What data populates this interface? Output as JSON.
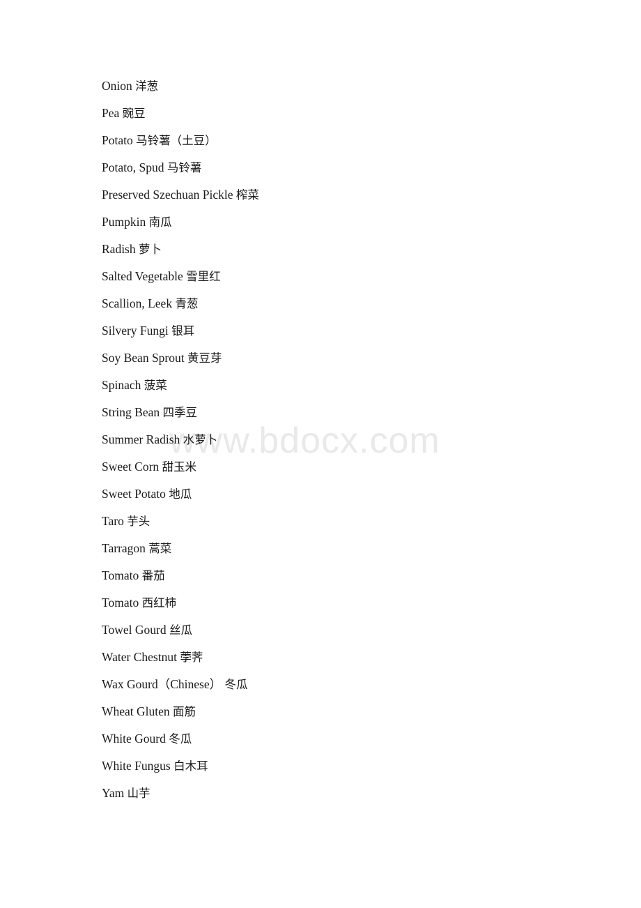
{
  "document": {
    "watermark": "www.bdocx.com",
    "entries": [
      {
        "english": "Onion",
        "chinese": "洋葱",
        "text": "Onion 洋葱"
      },
      {
        "english": "Pea",
        "chinese": "豌豆",
        "text": "Pea 豌豆"
      },
      {
        "english": "Potato",
        "chinese": "马铃薯（土豆）",
        "text": "Potato 马铃薯（土豆）"
      },
      {
        "english": "Potato, Spud",
        "chinese": "马铃薯",
        "text": "Potato, Spud 马铃薯"
      },
      {
        "english": "Preserved Szechuan Pickle",
        "chinese": "榨菜",
        "text": "Preserved Szechuan Pickle 榨菜"
      },
      {
        "english": "Pumpkin",
        "chinese": "南瓜",
        "text": "Pumpkin 南瓜"
      },
      {
        "english": "Radish",
        "chinese": "萝卜",
        "text": "Radish 萝卜"
      },
      {
        "english": "Salted Vegetable",
        "chinese": "雪里红",
        "text": "Salted Vegetable 雪里红"
      },
      {
        "english": "Scallion, Leek",
        "chinese": "青葱",
        "text": "Scallion, Leek 青葱"
      },
      {
        "english": "Silvery Fungi",
        "chinese": "银耳",
        "text": "Silvery Fungi 银耳"
      },
      {
        "english": "Soy Bean Sprout",
        "chinese": "黄豆芽",
        "text": "Soy Bean Sprout 黄豆芽"
      },
      {
        "english": "Spinach",
        "chinese": "菠菜",
        "text": "Spinach 菠菜"
      },
      {
        "english": "String Bean",
        "chinese": "四季豆",
        "text": "String Bean 四季豆"
      },
      {
        "english": "Summer Radish",
        "chinese": "水萝卜",
        "text": "Summer Radish 水萝卜"
      },
      {
        "english": "Sweet Corn",
        "chinese": "甜玉米",
        "text": "Sweet Corn 甜玉米"
      },
      {
        "english": "Sweet Potato",
        "chinese": "地瓜",
        "text": "Sweet Potato 地瓜"
      },
      {
        "english": "Taro",
        "chinese": "芋头",
        "text": "Taro 芋头"
      },
      {
        "english": "Tarragon",
        "chinese": "蒿菜",
        "text": "Tarragon 蒿菜"
      },
      {
        "english": "Tomato",
        "chinese": "番茄",
        "text": "Tomato 番茄"
      },
      {
        "english": "Tomato",
        "chinese": "西红柿",
        "text": "Tomato 西红柿"
      },
      {
        "english": "Towel Gourd",
        "chinese": "丝瓜",
        "text": "Towel Gourd 丝瓜"
      },
      {
        "english": "Water Chestnut",
        "chinese": "荸荠",
        "text": "Water Chestnut 荸荠"
      },
      {
        "english": "Wax Gourd（Chinese）",
        "chinese": "冬瓜",
        "text": "Wax Gourd（Chinese） 冬瓜"
      },
      {
        "english": "Wheat Gluten",
        "chinese": "面筋",
        "text": "Wheat Gluten 面筋"
      },
      {
        "english": "White Gourd",
        "chinese": "冬瓜",
        "text": "White Gourd 冬瓜"
      },
      {
        "english": "White Fungus",
        "chinese": "白木耳",
        "text": "White Fungus 白木耳"
      },
      {
        "english": "Yam",
        "chinese": "山芋",
        "text": "Yam 山芋"
      }
    ]
  }
}
